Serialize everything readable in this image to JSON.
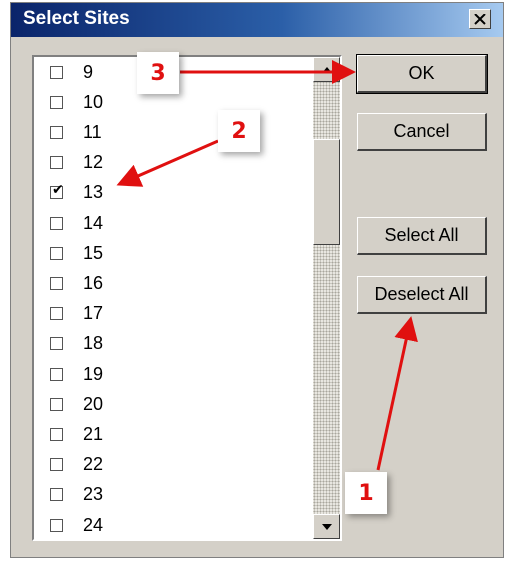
{
  "dialog": {
    "title": "Select Sites",
    "close_icon": "close-icon"
  },
  "sites": {
    "items": [
      {
        "label": "9",
        "checked": false
      },
      {
        "label": "10",
        "checked": false
      },
      {
        "label": "11",
        "checked": false
      },
      {
        "label": "12",
        "checked": false
      },
      {
        "label": "13",
        "checked": true
      },
      {
        "label": "14",
        "checked": false
      },
      {
        "label": "15",
        "checked": false
      },
      {
        "label": "16",
        "checked": false
      },
      {
        "label": "17",
        "checked": false
      },
      {
        "label": "18",
        "checked": false
      },
      {
        "label": "19",
        "checked": false
      },
      {
        "label": "20",
        "checked": false
      },
      {
        "label": "21",
        "checked": false
      },
      {
        "label": "22",
        "checked": false
      },
      {
        "label": "23",
        "checked": false
      },
      {
        "label": "24",
        "checked": false
      }
    ]
  },
  "buttons": {
    "ok": "OK",
    "cancel": "Cancel",
    "select_all": "Select All",
    "deselect_all": "Deselect All"
  },
  "annotations": {
    "step1": "1",
    "step2": "2",
    "step3": "3",
    "color": "#e01010"
  }
}
